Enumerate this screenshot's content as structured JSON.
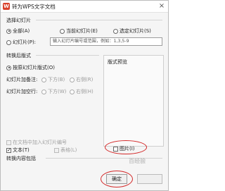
{
  "window": {
    "title": "转为WPS文字文档",
    "app_icon_letter": "W",
    "close_glyph": "×"
  },
  "select_slides": {
    "group_label": "选择幻灯片",
    "options": [
      "全部(A)",
      "当前幻灯片(E)",
      "选定幻灯片(S)"
    ],
    "selected": "全部(A)",
    "range_option": "幻灯片(P):",
    "range_placeholder": "输入幻灯片编号或范围，例如：1,3,5-9"
  },
  "layout": {
    "group_label": "转换后版式",
    "layout_option": "按原幻灯片版式(O)",
    "add_comments_label": "幻灯片加备注:",
    "add_comments_options": [
      "下方(B)",
      "右侧(R)"
    ],
    "add_blank_label": "幻灯片加空行:",
    "add_blank_options": [
      "下方(W)",
      "右侧(H)"
    ],
    "insert_slide_number": "在文档中加入幻灯片编号",
    "preview_label": "版式预览"
  },
  "content": {
    "group_label": "转换内容包括",
    "text_label": "文本(T)",
    "text_checked": true,
    "table_label": "表格(L)",
    "image_label": "图片(I)",
    "image_checked": false
  },
  "buttons": {
    "ok_label": "确定",
    "cancel_label": ""
  },
  "watermark": "百经验",
  "highlight_color": "#d32828"
}
